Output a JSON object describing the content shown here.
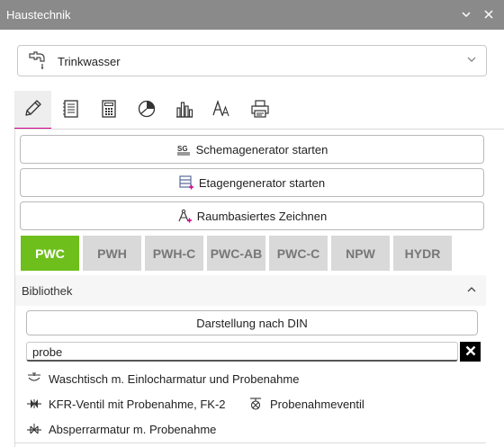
{
  "window": {
    "title": "Haustechnik",
    "caret_icon": "chevron-down-icon",
    "close_icon": "close-icon"
  },
  "dropdown": {
    "value": "Trinkwasser",
    "icon": "faucet-icon"
  },
  "tabs": [
    {
      "name": "draw",
      "icon": "pencil-icon"
    },
    {
      "name": "list",
      "icon": "list-icon"
    },
    {
      "name": "calc",
      "icon": "calculator-icon"
    },
    {
      "name": "chart",
      "icon": "pie-chart-icon"
    },
    {
      "name": "bars",
      "icon": "bar-chart-icon"
    },
    {
      "name": "text",
      "icon": "text-size-icon"
    },
    {
      "name": "print",
      "icon": "printer-icon"
    }
  ],
  "buttons": {
    "schema": "Schemagenerator starten",
    "etage": "Etagengenerator starten",
    "raum": "Raumbasiertes Zeichnen"
  },
  "categories": [
    "PWC",
    "PWH",
    "PWH-C",
    "PWC-AB",
    "PWC-C",
    "NPW",
    "HYDR"
  ],
  "active_category": "PWC",
  "colors": {
    "active_category": "#6ebf1c",
    "accent": "#d6008a"
  },
  "library": {
    "title": "Bibliothek",
    "din_button": "Darstellung nach DIN",
    "search_value": "probe",
    "results": [
      {
        "label": "Waschtisch m. Einlocharmatur und Probenahme",
        "icon": "washbasin-icon"
      },
      {
        "label": "KFR-Ventil mit Probenahme, FK-2",
        "icon": "check-valve-icon"
      },
      {
        "label": "Probenahmeventil",
        "icon": "sampling-valve-icon"
      },
      {
        "label": "Absperrarmatur m. Probenahme",
        "icon": "shutoff-valve-icon"
      }
    ]
  }
}
